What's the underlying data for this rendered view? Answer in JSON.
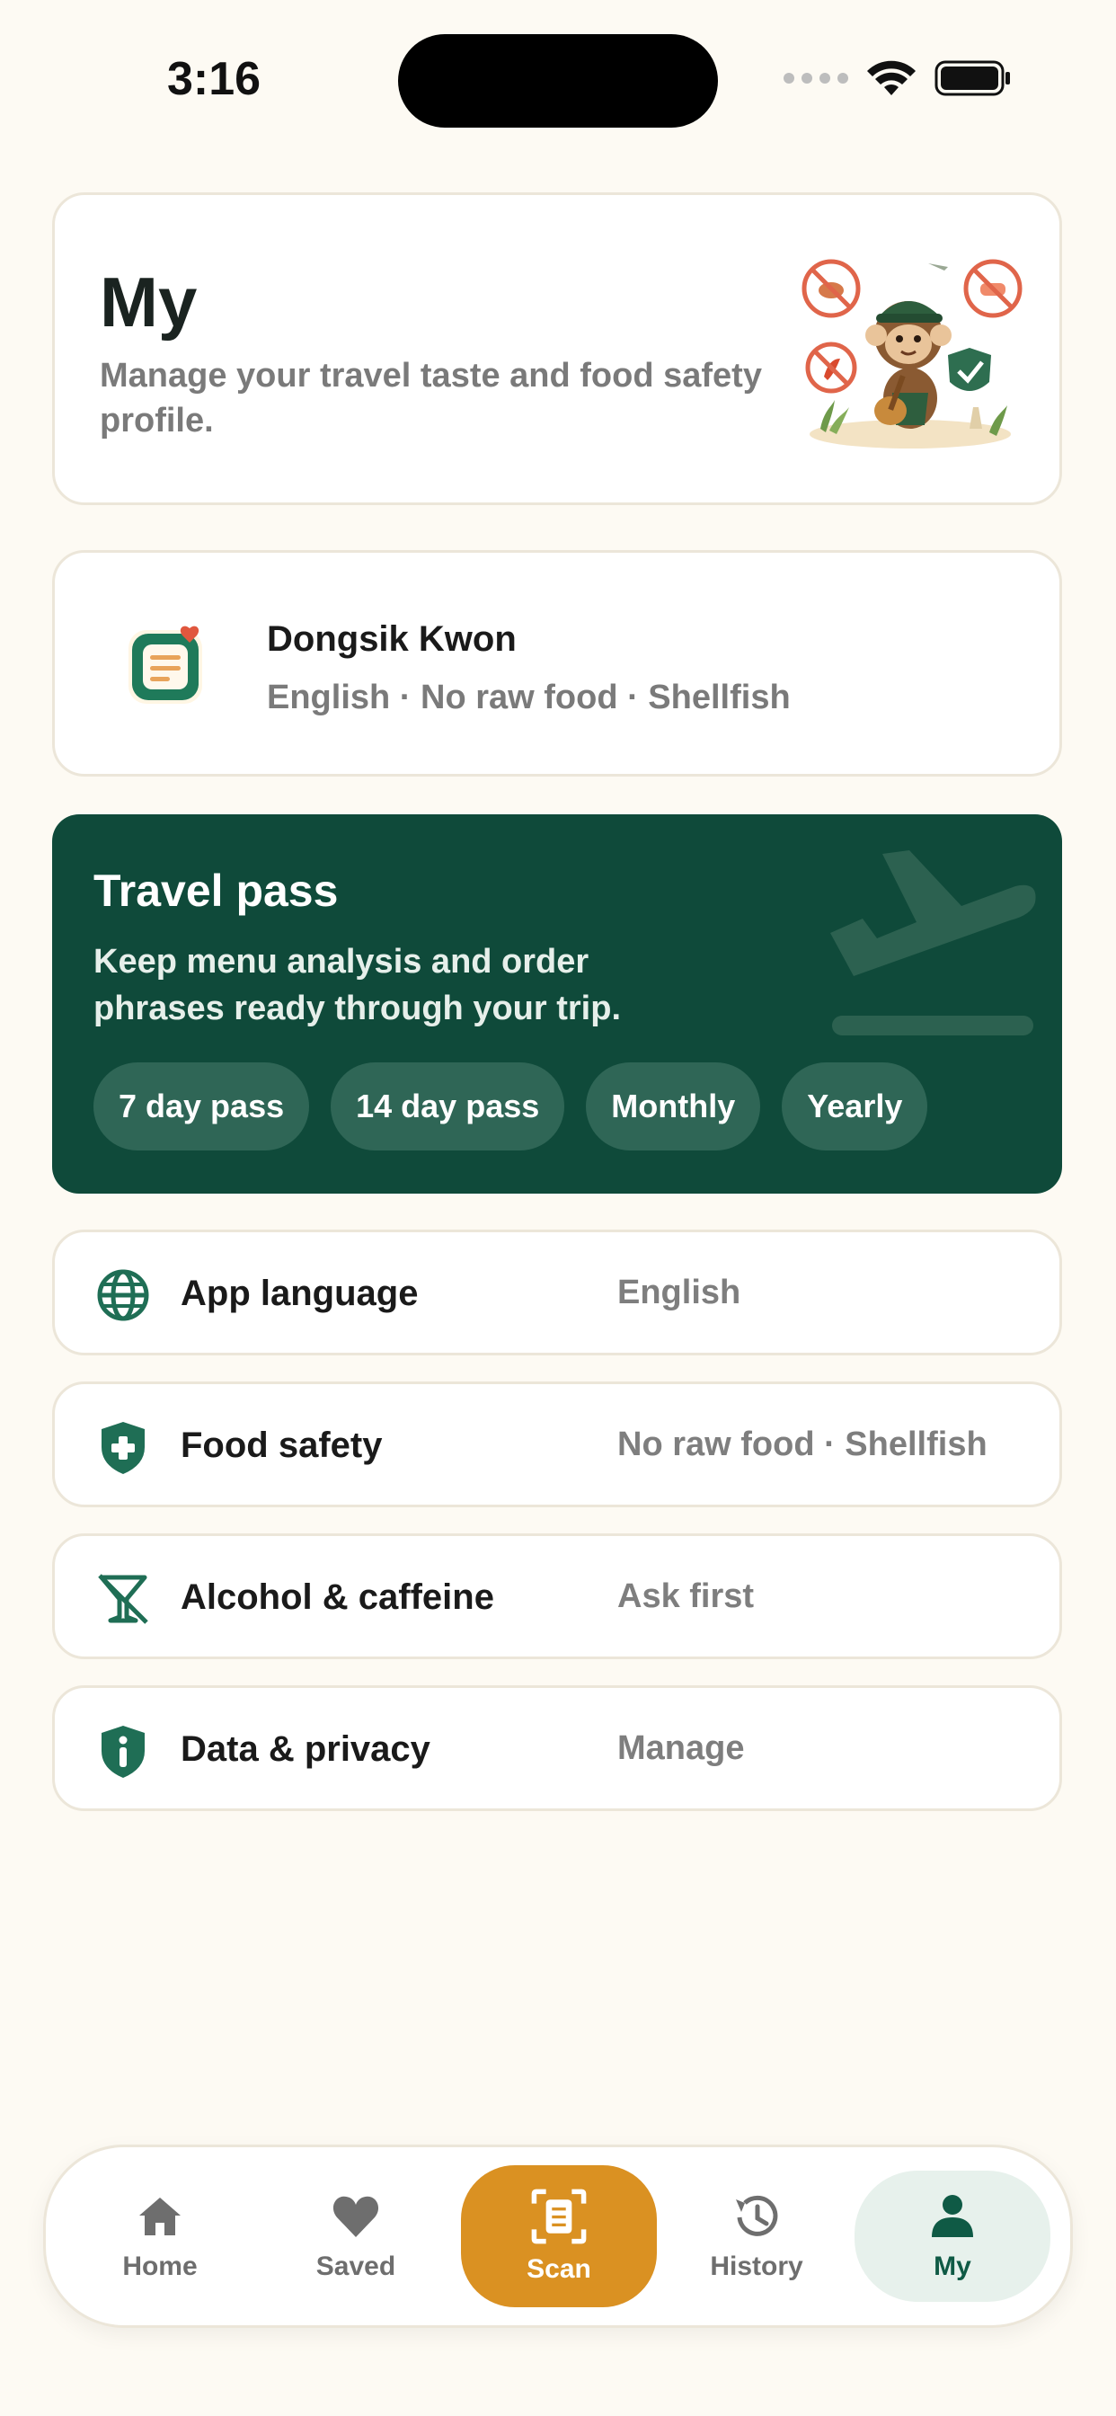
{
  "status_bar": {
    "time": "3:16"
  },
  "header": {
    "title": "My",
    "subtitle": "Manage your travel taste and food safety profile."
  },
  "profile": {
    "name": "Dongsik Kwon",
    "meta": "English · No raw food · Shellfish"
  },
  "travel_pass": {
    "title": "Travel pass",
    "description": "Keep menu analysis and order phrases ready through your trip.",
    "options": [
      "7 day pass",
      "14 day pass",
      "Monthly",
      "Yearly"
    ]
  },
  "settings": [
    {
      "label": "App language",
      "value": "English",
      "icon": "globe-icon"
    },
    {
      "label": "Food safety",
      "value": "No raw food · Shellfish",
      "icon": "shield-plus-icon"
    },
    {
      "label": "Alcohol & caffeine",
      "value": "Ask first",
      "icon": "no-drink-icon"
    },
    {
      "label": "Data & privacy",
      "value": "Manage",
      "icon": "info-shield-icon"
    }
  ],
  "tabs": [
    {
      "label": "Home",
      "icon": "home-icon"
    },
    {
      "label": "Saved",
      "icon": "heart-icon"
    },
    {
      "label": "Scan",
      "icon": "scan-icon"
    },
    {
      "label": "History",
      "icon": "history-icon"
    },
    {
      "label": "My",
      "icon": "person-icon",
      "active": true
    }
  ],
  "colors": {
    "background": "#FDFAF3",
    "primary_green": "#0F4A3A",
    "accent_orange": "#DA9122",
    "muted_text": "#7A7A7A"
  }
}
